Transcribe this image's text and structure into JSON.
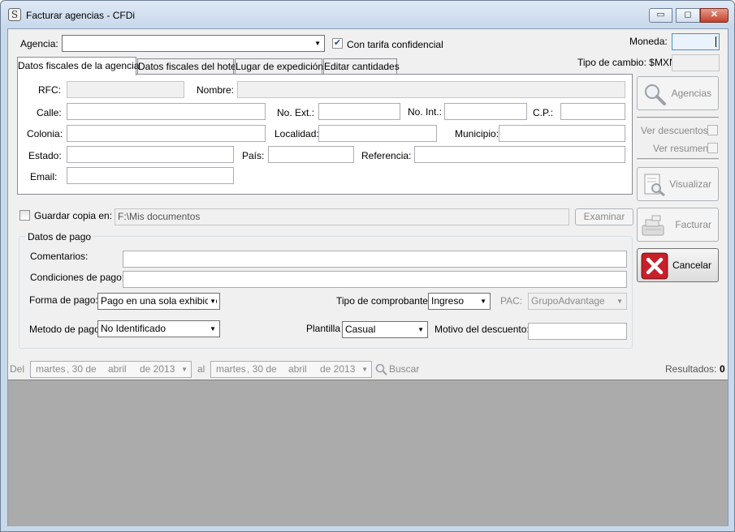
{
  "window": {
    "title": "Facturar agencias - CFDi",
    "app_icon_glyph": "S",
    "minimize_glyph": "▭",
    "maximize_glyph": "◻",
    "close_glyph": "✕"
  },
  "header": {
    "agencia_label": "Agencia:",
    "agencia_value": "",
    "tarifa_label": "Con tarifa confidencial",
    "tarifa_checked": true,
    "moneda_label": "Moneda:",
    "moneda_value": "",
    "tipo_cambio_label": "Tipo de cambio: $MXN",
    "tipo_cambio_value": ""
  },
  "tabs": [
    {
      "label": "Datos fiscales de la agencia",
      "active": true
    },
    {
      "label": "Datos fiscales del hotel",
      "active": false
    },
    {
      "label": "Lugar de expedición",
      "active": false
    },
    {
      "label": "Editar cantidades",
      "active": false
    }
  ],
  "fiscal": {
    "rfc_label": "RFC:",
    "rfc_value": "",
    "nombre_label": "Nombre:",
    "nombre_value": "",
    "calle_label": "Calle:",
    "calle_value": "",
    "no_ext_label": "No. Ext.:",
    "no_ext_value": "",
    "no_int_label": "No. Int.:",
    "no_int_value": "",
    "cp_label": "C.P.:",
    "cp_value": "",
    "colonia_label": "Colonia:",
    "colonia_value": "",
    "localidad_label": "Localidad:",
    "localidad_value": "",
    "municipio_label": "Municipio:",
    "municipio_value": "",
    "estado_label": "Estado:",
    "estado_value": "",
    "pais_label": "País:",
    "pais_value": "",
    "referencia_label": "Referencia:",
    "referencia_value": "",
    "email_label": "Email:",
    "email_value": ""
  },
  "side": {
    "agencias_label": "Agencias",
    "ver_descuentos_label": "Ver descuentos",
    "ver_resumen_label": "Ver resumen",
    "visualizar_label": "Visualizar",
    "facturar_label": "Facturar",
    "cancelar_label": "Cancelar"
  },
  "copy": {
    "guardar_label": "Guardar copia en:",
    "guardar_checked": false,
    "path_value": "F:\\Mis documentos",
    "examinar_label": "Examinar"
  },
  "pago": {
    "group_title": "Datos de pago",
    "comentarios_label": "Comentarios:",
    "comentarios_value": "",
    "condiciones_label": "Condiciones de pago:",
    "condiciones_value": "",
    "forma_label": "Forma de pago:",
    "forma_value": "Pago en una sola exhibició",
    "tipo_comprobante_label": "Tipo de comprobante:",
    "tipo_comprobante_value": "Ingreso",
    "pac_label": "PAC:",
    "pac_value": "GrupoAdvantage",
    "metodo_label": "Metodo de pago:",
    "metodo_value": "No Identificado",
    "plantilla_label": "Plantilla",
    "plantilla_value": "Casual",
    "motivo_label": "Motivo del descuento:",
    "motivo_value": ""
  },
  "search": {
    "del_label": "Del",
    "from_date": {
      "weekday": "martes",
      "day": ", 30 de",
      "month": "abril",
      "year": "de 2013"
    },
    "al_label": "al",
    "to_date": {
      "weekday": "martes",
      "day": ", 30 de",
      "month": "abril",
      "year": "de 2013"
    },
    "buscar_label": "Buscar",
    "resultados_label": "Resultados:",
    "resultados_count": "0"
  }
}
